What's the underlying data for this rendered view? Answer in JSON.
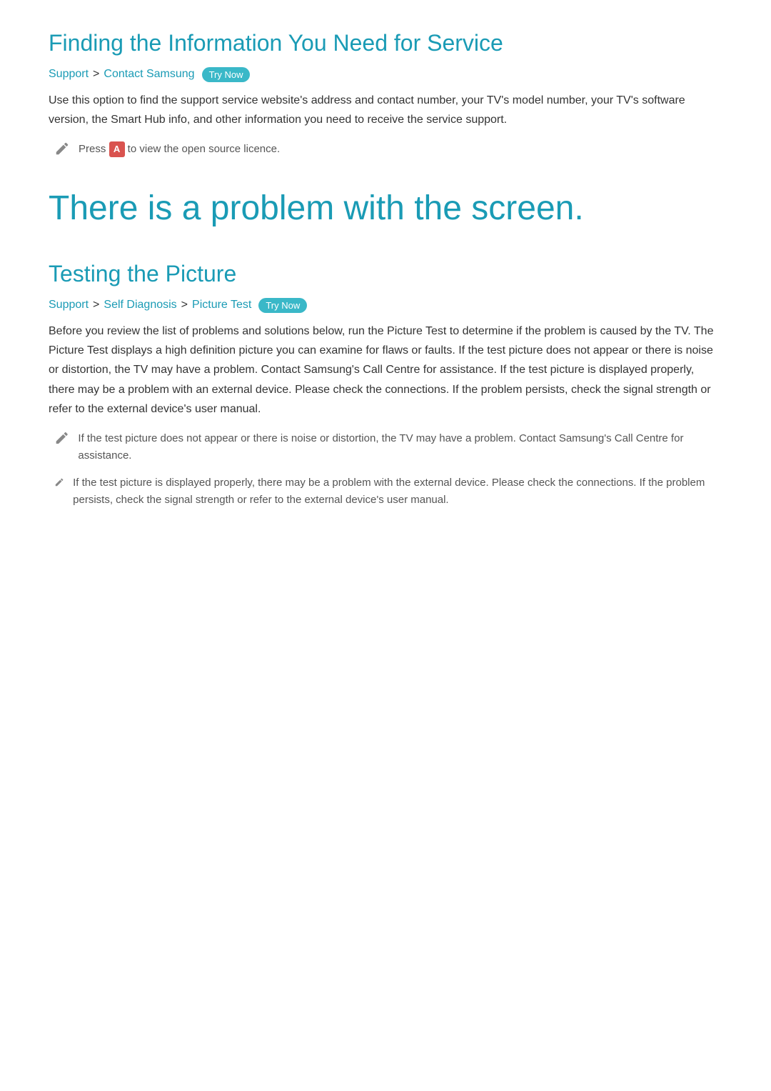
{
  "section1": {
    "title": "Finding the Information You Need for Service",
    "breadcrumb": {
      "part1": "Support",
      "separator1": ">",
      "part2": "Contact Samsung",
      "badge": "Try Now"
    },
    "body": "Use this option to find the support service website's address and contact number, your TV's model number, your TV's software version, the Smart Hub info, and other information you need to receive the service support.",
    "press_note": {
      "prefix": "Press",
      "key": "A",
      "suffix": "to view the open source licence."
    }
  },
  "section2": {
    "title": "There is a problem with the screen.",
    "subsection": {
      "title": "Testing the Picture",
      "breadcrumb": {
        "part1": "Support",
        "separator1": ">",
        "part2": "Self Diagnosis",
        "separator2": ">",
        "part3": "Picture Test",
        "badge": "Try Now"
      },
      "body": "Before you review the list of problems and solutions below, run the Picture Test to determine if the problem is caused by the TV. The Picture Test displays a high definition picture you can examine for flaws or faults. If the test picture does not appear or there is noise or distortion, the TV may have a problem. Contact Samsung's Call Centre for assistance. If the test picture is displayed properly, there may be a problem with an external device. Please check the connections. If the problem persists, check the signal strength or refer to the external device's user manual.",
      "notes": [
        {
          "id": "note1",
          "text": "If the test picture does not appear or there is noise or distortion, the TV may have a problem. Contact Samsung's Call Centre for assistance."
        },
        {
          "id": "note2",
          "text": "If the test picture is displayed properly, there may be a problem with the external device. Please check the connections. If the problem persists, check the signal strength or refer to the external device's user manual."
        }
      ]
    }
  },
  "colors": {
    "accent": "#1a9bb5",
    "badge_bg": "#3ab8c8",
    "key_bg": "#d9534f",
    "body_text": "#333333",
    "note_text": "#555555"
  }
}
